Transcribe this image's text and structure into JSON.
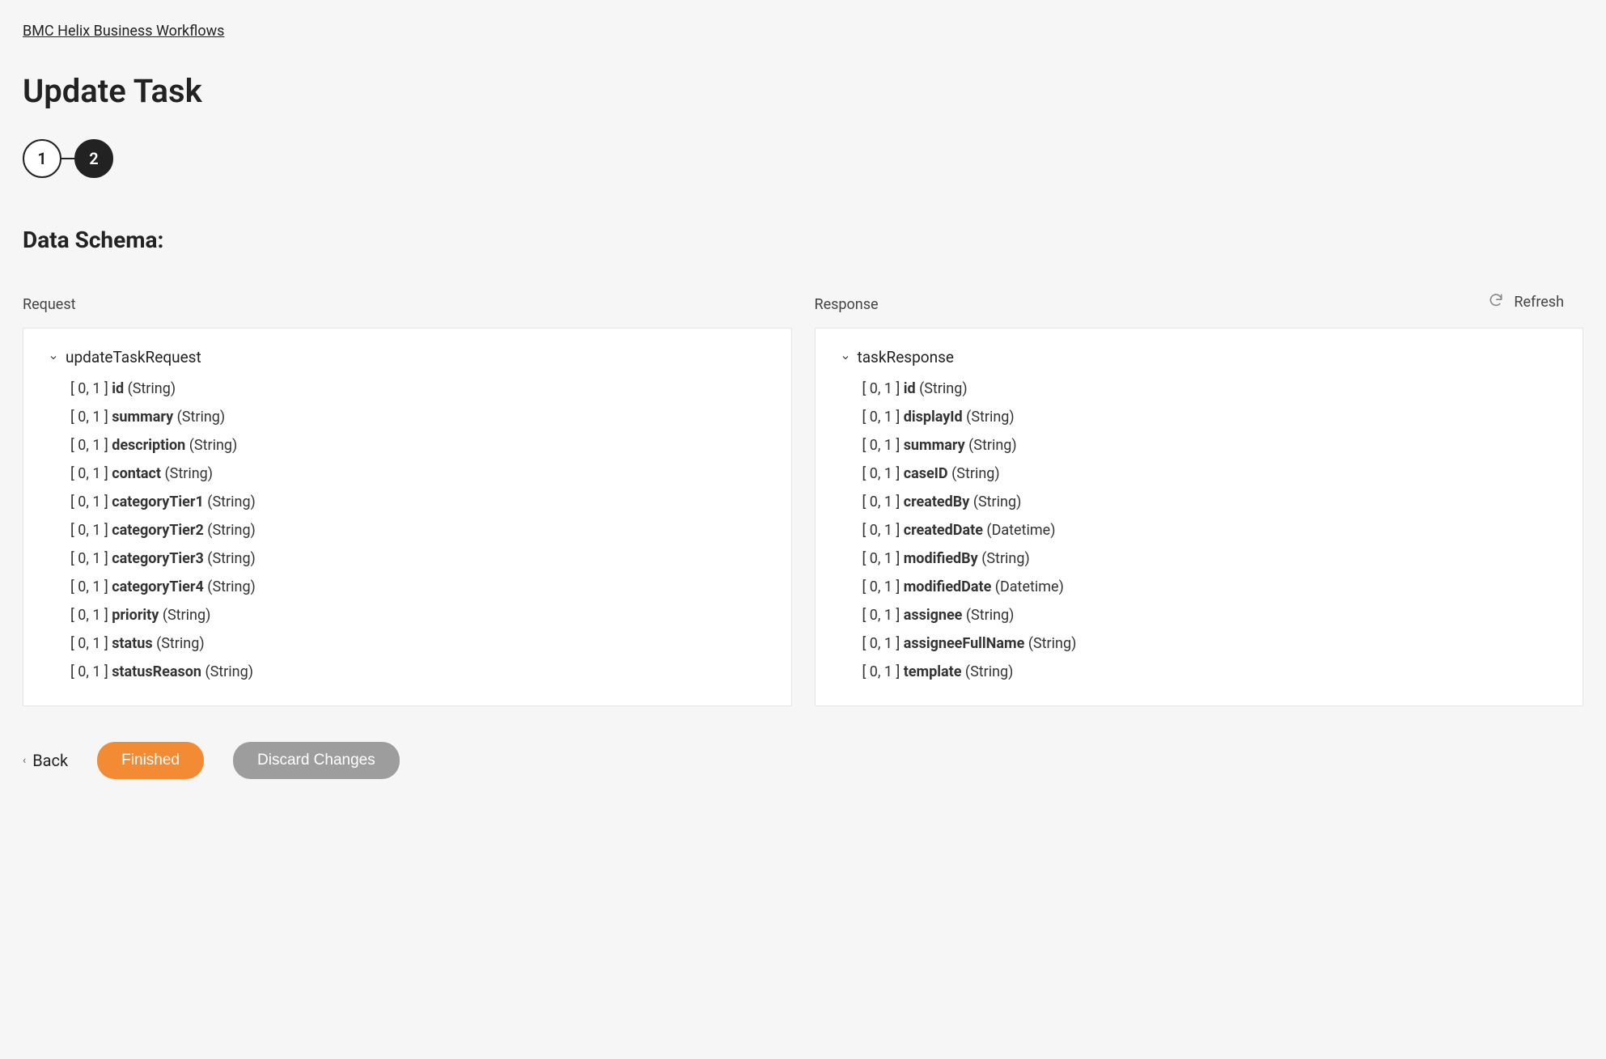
{
  "breadcrumb": "BMC Helix Business Workflows",
  "page_title": "Update Task",
  "stepper": {
    "step1": "1",
    "step2": "2"
  },
  "section_title": "Data Schema:",
  "refresh_label": "Refresh",
  "request": {
    "label": "Request",
    "root": "updateTaskRequest",
    "fields": [
      {
        "card": "[ 0, 1 ]",
        "name": "id",
        "type": "(String)"
      },
      {
        "card": "[ 0, 1 ]",
        "name": "summary",
        "type": "(String)"
      },
      {
        "card": "[ 0, 1 ]",
        "name": "description",
        "type": "(String)"
      },
      {
        "card": "[ 0, 1 ]",
        "name": "contact",
        "type": "(String)"
      },
      {
        "card": "[ 0, 1 ]",
        "name": "categoryTier1",
        "type": "(String)"
      },
      {
        "card": "[ 0, 1 ]",
        "name": "categoryTier2",
        "type": "(String)"
      },
      {
        "card": "[ 0, 1 ]",
        "name": "categoryTier3",
        "type": "(String)"
      },
      {
        "card": "[ 0, 1 ]",
        "name": "categoryTier4",
        "type": "(String)"
      },
      {
        "card": "[ 0, 1 ]",
        "name": "priority",
        "type": "(String)"
      },
      {
        "card": "[ 0, 1 ]",
        "name": "status",
        "type": "(String)"
      },
      {
        "card": "[ 0, 1 ]",
        "name": "statusReason",
        "type": "(String)"
      }
    ]
  },
  "response": {
    "label": "Response",
    "root": "taskResponse",
    "fields": [
      {
        "card": "[ 0, 1 ]",
        "name": "id",
        "type": "(String)"
      },
      {
        "card": "[ 0, 1 ]",
        "name": "displayId",
        "type": "(String)"
      },
      {
        "card": "[ 0, 1 ]",
        "name": "summary",
        "type": "(String)"
      },
      {
        "card": "[ 0, 1 ]",
        "name": "caseID",
        "type": "(String)"
      },
      {
        "card": "[ 0, 1 ]",
        "name": "createdBy",
        "type": "(String)"
      },
      {
        "card": "[ 0, 1 ]",
        "name": "createdDate",
        "type": "(Datetime)"
      },
      {
        "card": "[ 0, 1 ]",
        "name": "modifiedBy",
        "type": "(String)"
      },
      {
        "card": "[ 0, 1 ]",
        "name": "modifiedDate",
        "type": "(Datetime)"
      },
      {
        "card": "[ 0, 1 ]",
        "name": "assignee",
        "type": "(String)"
      },
      {
        "card": "[ 0, 1 ]",
        "name": "assigneeFullName",
        "type": "(String)"
      },
      {
        "card": "[ 0, 1 ]",
        "name": "template",
        "type": "(String)"
      }
    ]
  },
  "footer": {
    "back": "Back",
    "finished": "Finished",
    "discard": "Discard Changes"
  }
}
